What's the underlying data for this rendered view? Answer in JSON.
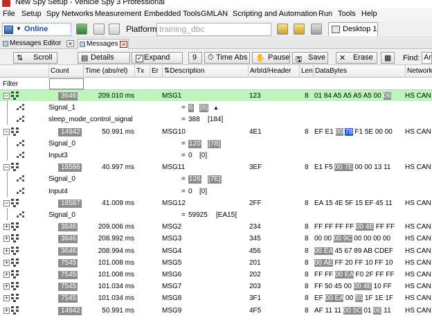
{
  "window": {
    "title": "New Spy Setup - Vehicle Spy 3 Professional"
  },
  "menu": [
    "File",
    "Setup",
    "Spy Networks",
    "Measurement",
    "Embedded Tools",
    "GMLAN",
    "Scripting and Automation",
    "Run",
    "Tools",
    "Help"
  ],
  "toolbar": {
    "online_label": "Online",
    "platform_label": "Platform:",
    "platform_value": "training_dbc",
    "desktop_tab": "Desktop 1"
  },
  "tabs": {
    "messages_editor": "Messages Editor",
    "messages": "Messages"
  },
  "toolbar2": {
    "scroll": "Scroll",
    "details": "Details",
    "expand": "Expand",
    "expand_checked": true,
    "nine": "9",
    "time_abs": "Time Abs",
    "pause": "Pause",
    "save": "Save",
    "erase": "Erase",
    "find": "Find:",
    "find_value": "Ar"
  },
  "columns": {
    "count": "Count",
    "time": "Time (abs/rel)",
    "tx": "Tx",
    "er": "Er",
    "desc": "Description",
    "arbid": "ArbId/Header",
    "len": "Len",
    "databytes": "DataBytes",
    "network": "Network"
  },
  "filter_label": "Filter",
  "colors": {
    "highlight_row": "#bdf5bd",
    "gray_cell": "#8c8c8c",
    "selected_byte": "#1e5ad8"
  },
  "rows": [
    {
      "type": "msg",
      "expanded": true,
      "highlight": true,
      "count": "3646",
      "time": "209.010 ms",
      "desc": "MSG1",
      "arb": "123",
      "len": "8",
      "db": [
        {
          "t": "01 84 A5 A5 A5 A5 00 "
        },
        {
          "t": "06",
          "h": "gray"
        }
      ],
      "net": "HS CAN"
    },
    {
      "type": "sig",
      "name": "Signal_1",
      "eq": "=",
      "val": "6",
      "val_gray": true,
      "raw": "[6]",
      "raw_gray": true,
      "extra": "▲"
    },
    {
      "type": "sig",
      "name": "sleep_mode_control_signal",
      "eq": "=",
      "val": "388",
      "val_gray": false,
      "raw": "[184]",
      "raw_gray": false
    },
    {
      "type": "msg",
      "expanded": true,
      "count": "14942",
      "time": "50.991 ms",
      "desc": "MSG10",
      "arb": "4E1",
      "len": "8",
      "db": [
        {
          "t": "EF E1 "
        },
        {
          "t": "00",
          "h": "gray"
        },
        {
          "t": " "
        },
        {
          "t": "78",
          "h": "blue"
        },
        {
          "t": " F1 5E 00 00"
        }
      ],
      "net": "HS CAN"
    },
    {
      "type": "sig",
      "name": "Signal_0",
      "eq": "=",
      "val": "120",
      "val_gray": true,
      "raw": "[78]",
      "raw_gray": true
    },
    {
      "type": "sig",
      "name": "Input3",
      "eq": "=",
      "val": "0",
      "val_gray": false,
      "raw": "[0]",
      "raw_gray": false
    },
    {
      "type": "msg",
      "expanded": true,
      "count": "18586",
      "time": "40.997 ms",
      "desc": "MSG11",
      "arb": "3EF",
      "len": "8",
      "db": [
        {
          "t": "E1 F5 "
        },
        {
          "t": "00 7E",
          "h": "gray"
        },
        {
          "t": " 00 00 13 11"
        }
      ],
      "net": "HS CAN"
    },
    {
      "type": "sig",
      "name": "Signal_0",
      "eq": "=",
      "val": "126",
      "val_gray": true,
      "raw": "[7E]",
      "raw_gray": true
    },
    {
      "type": "sig",
      "name": "Input4",
      "eq": "=",
      "val": "0",
      "val_gray": false,
      "raw": "[0]",
      "raw_gray": false
    },
    {
      "type": "msg",
      "expanded": true,
      "count": "18587",
      "time": "41.009 ms",
      "desc": "MSG12",
      "arb": "2FF",
      "len": "8",
      "db": [
        {
          "t": "EA 15 4E 5F 15 EF 45 11"
        }
      ],
      "net": "HS CAN"
    },
    {
      "type": "sig",
      "name": "Signal_0",
      "eq": "=",
      "val": "59925",
      "val_gray": false,
      "raw": "[EA15]",
      "raw_gray": false
    },
    {
      "type": "msg",
      "expanded": false,
      "count": "3646",
      "time": "209.006 ms",
      "desc": "MSG2",
      "arb": "234",
      "len": "8",
      "db": [
        {
          "t": "FF FF FF FF "
        },
        {
          "t": "00 4E",
          "h": "gray"
        },
        {
          "t": " FF FF"
        }
      ],
      "net": "HS CAN"
    },
    {
      "type": "msg",
      "expanded": false,
      "count": "3646",
      "time": "208.992 ms",
      "desc": "MSG3",
      "arb": "345",
      "len": "8",
      "db": [
        {
          "t": "00 00 "
        },
        {
          "t": "00 9C",
          "h": "gray"
        },
        {
          "t": " 00 00 00 00"
        }
      ],
      "net": "HS CAN"
    },
    {
      "type": "msg",
      "expanded": false,
      "count": "3646",
      "time": "208.994 ms",
      "desc": "MSG4",
      "arb": "456",
      "len": "8",
      "db": [
        {
          "t": "00 EA",
          "h": "gray"
        },
        {
          "t": " 45 67 89 AB CDEF"
        }
      ],
      "net": "HS CAN"
    },
    {
      "type": "msg",
      "expanded": false,
      "count": "7545",
      "time": "101.008 ms",
      "desc": "MSG5",
      "arb": "201",
      "len": "8",
      "db": [
        {
          "t": "00 AE",
          "h": "gray"
        },
        {
          "t": " FF 20 FF 10 FF 10"
        }
      ],
      "net": "HS CAN"
    },
    {
      "type": "msg",
      "expanded": false,
      "count": "7545",
      "time": "101.008 ms",
      "desc": "MSG6",
      "arb": "202",
      "len": "8",
      "db": [
        {
          "t": "FF FF "
        },
        {
          "t": "00 EA",
          "h": "gray"
        },
        {
          "t": " F0 2F FF FF"
        }
      ],
      "net": "HS CAN"
    },
    {
      "type": "msg",
      "expanded": false,
      "count": "7545",
      "time": "101.034 ms",
      "desc": "MSG7",
      "arb": "203",
      "len": "8",
      "db": [
        {
          "t": "FF 50 45 00 "
        },
        {
          "t": "00 4E",
          "h": "gray"
        },
        {
          "t": " 10 FF"
        }
      ],
      "net": "HS CAN"
    },
    {
      "type": "msg",
      "expanded": false,
      "count": "7545",
      "time": "101.034 ms",
      "desc": "MSG8",
      "arb": "3F1",
      "len": "8",
      "db": [
        {
          "t": "EF "
        },
        {
          "t": "00 EA",
          "h": "gray"
        },
        {
          "t": " 00 "
        },
        {
          "t": "55",
          "h": "gray"
        },
        {
          "t": " 1F 1E 1F"
        }
      ],
      "net": "HS CAN"
    },
    {
      "type": "msg",
      "expanded": false,
      "count": "14942",
      "time": "50.991 ms",
      "desc": "MSG9",
      "arb": "4F5",
      "len": "8",
      "db": [
        {
          "t": "AF 11 11 "
        },
        {
          "t": "00 5C",
          "h": "gray"
        },
        {
          "t": " 01 "
        },
        {
          "t": "0E",
          "h": "gray"
        },
        {
          "t": " 11"
        }
      ],
      "net": "HS CAN"
    }
  ]
}
